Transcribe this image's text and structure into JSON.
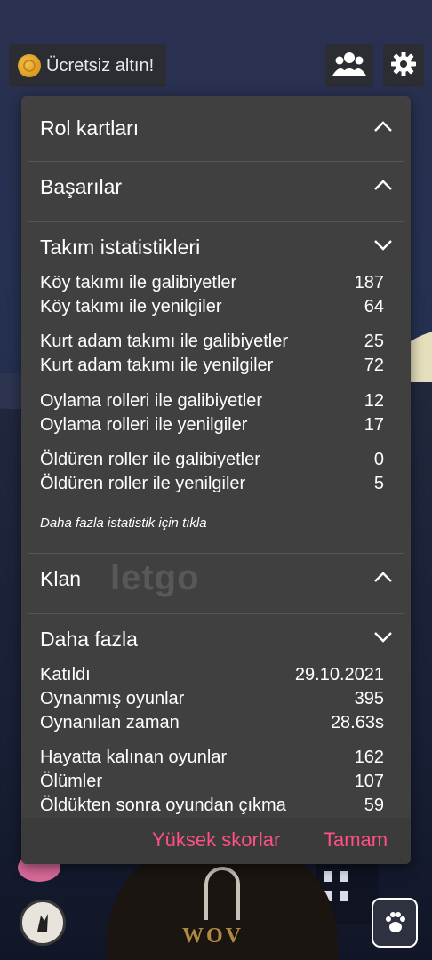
{
  "topbar": {
    "free_gold_label": "Ücretsiz altın!",
    "friends_icon": "friends-icon",
    "settings_icon": "gear-icon"
  },
  "sections": {
    "role_cards": "Rol kartları",
    "achievements": "Başarılar",
    "team_stats": "Takım istatistikleri",
    "clan": "Klan",
    "more": "Daha fazla"
  },
  "team_stats": [
    {
      "label": "Köy takımı ile galibiyetler",
      "value": "187"
    },
    {
      "label": "Köy takımı ile yenilgiler",
      "value": "64"
    },
    {
      "label": "Kurt adam takımı ile galibiyetler",
      "value": "25"
    },
    {
      "label": "Kurt adam takımı ile yenilgiler",
      "value": "72"
    },
    {
      "label": "Oylama rolleri ile galibiyetler",
      "value": "12"
    },
    {
      "label": "Oylama rolleri ile yenilgiler",
      "value": "17"
    },
    {
      "label": "Öldüren roller ile galibiyetler",
      "value": "0"
    },
    {
      "label": "Öldüren roller ile yenilgiler",
      "value": "5"
    }
  ],
  "more_stats_link": "Daha fazla istatistik için tıkla",
  "more_stats": [
    {
      "label": "Katıldı",
      "value": "29.10.2021"
    },
    {
      "label": "Oynanmış oyunlar",
      "value": "395"
    },
    {
      "label": "Oynanılan zaman",
      "value": "28.63s"
    },
    {
      "label": "Hayatta kalınan oyunlar",
      "value": "162"
    },
    {
      "label": "Ölümler",
      "value": "107"
    },
    {
      "label": "Öldükten sonra oyundan çıkma",
      "value": "59"
    }
  ],
  "footer": {
    "high_scores": "Yüksek skorlar",
    "ok": "Tamam"
  },
  "background": {
    "logo_text": "WOV",
    "watermark": "letgo"
  },
  "colors": {
    "panel_bg": "#404040",
    "accent_pink": "#ff4f83",
    "divider": "#565656"
  }
}
